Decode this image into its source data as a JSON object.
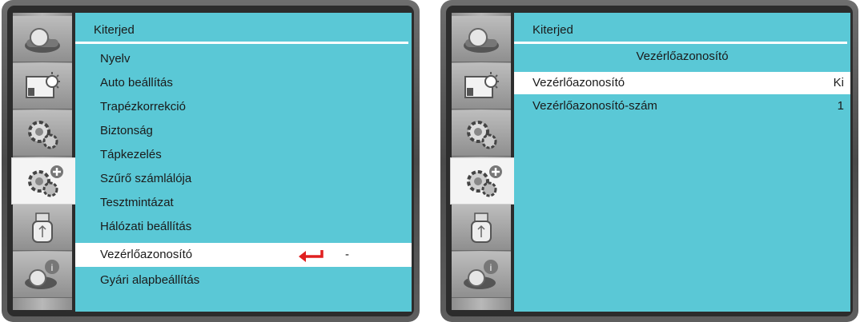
{
  "left_screen": {
    "title": "Kiterjed",
    "menu_items": [
      {
        "label": "Nyelv"
      },
      {
        "label": "Auto beállítás"
      },
      {
        "label": "Trapézkorrekció"
      },
      {
        "label": "Biztonság"
      },
      {
        "label": "Tápkezelés"
      },
      {
        "label": "Szűrő számlálója"
      },
      {
        "label": "Tesztmintázat"
      },
      {
        "label": "Hálózati beállítás"
      },
      {
        "label": "Vezérlőazonosító",
        "value": "-"
      },
      {
        "label": "Gyári alapbeállítás"
      }
    ]
  },
  "right_screen": {
    "title": "Kiterjed",
    "subheader": "Vezérlőazonosító",
    "rows": [
      {
        "label": "Vezérlőazonosító",
        "value": "Ki"
      },
      {
        "label": "Vezérlőazonosító-szám",
        "value": "1"
      }
    ]
  },
  "icons": [
    "projector-icon",
    "picture-setting-icon",
    "gear-icon",
    "extended-gear-icon",
    "usb-icon",
    "info-icon"
  ],
  "colors": {
    "panel": "#5ac8d6",
    "highlight": "#ffffff",
    "enter_arrow": "#e02020"
  }
}
